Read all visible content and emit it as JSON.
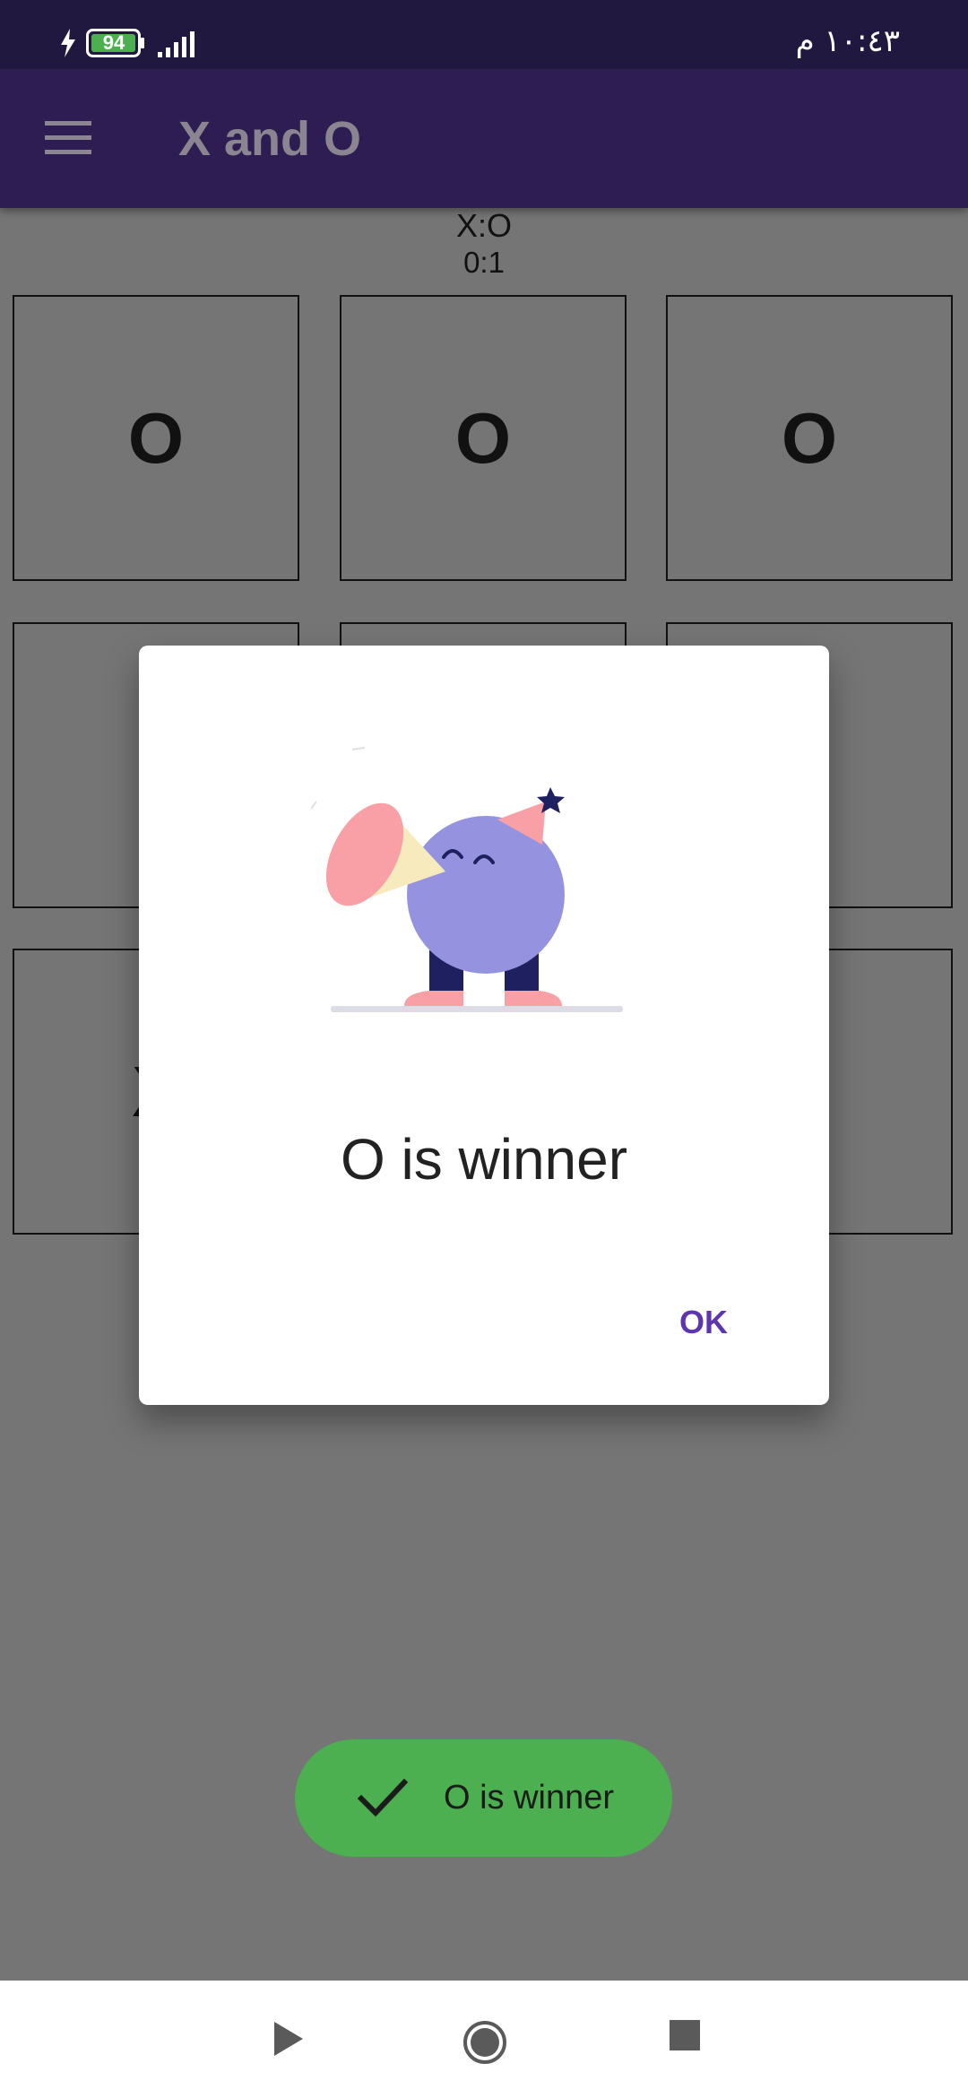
{
  "status_bar": {
    "battery_level": "94",
    "clock": "١٠:٤٣ م",
    "icons": [
      "charging-icon",
      "battery-icon",
      "signal-icon"
    ]
  },
  "app_bar": {
    "title": "X and O",
    "menu_icon": "menu-icon"
  },
  "score": {
    "labels": "X:O",
    "values": "0:1"
  },
  "board": {
    "cells": [
      "O",
      "O",
      "O",
      "",
      "",
      "",
      "X",
      "",
      ""
    ]
  },
  "dialog": {
    "illustration": "celebration-illustration",
    "message": "O is winner",
    "ok_label": "OK"
  },
  "toast": {
    "icon": "check-icon",
    "text": "O is winner"
  },
  "nav_bar": {
    "icons": [
      "back-icon",
      "home-icon",
      "recents-icon"
    ]
  },
  "colors": {
    "status_bar": "#211840",
    "app_bar": "#2e1d52",
    "accent": "#5e35b1",
    "toast": "#4caf50",
    "scrim_background": "#757575"
  }
}
